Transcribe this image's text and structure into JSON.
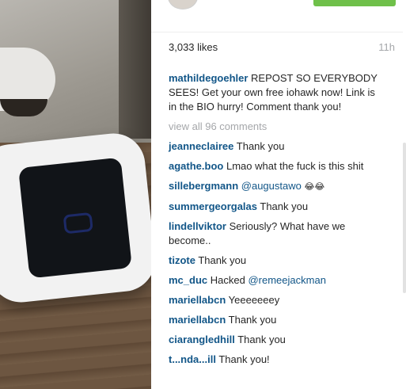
{
  "post": {
    "likes": "3,033 likes",
    "time": "11h",
    "caption": {
      "user": "mathildegoehler",
      "text": "REPOST SO EVERYBODY SEES! Get your own free iohawk now! Link is in the BIO hurry! Comment thank you!"
    },
    "view_all": "view all 96 comments"
  },
  "comments": [
    {
      "user": "jeanneclairee",
      "text": "Thank you"
    },
    {
      "user": "agathe.boo",
      "text": "Lmao what the fuck is this shit"
    },
    {
      "user": "sillebergmann",
      "mention": "@augustawo",
      "text": "😂😂"
    },
    {
      "user": "summergeorgalas",
      "text": "Thank you"
    },
    {
      "user": "lindellviktor",
      "text": "Seriously? What have we become.."
    },
    {
      "user": "tizote",
      "text": "Thank you"
    },
    {
      "user": "mc_duc",
      "text": "Hacked",
      "mention": "@remeejackman"
    },
    {
      "user": "mariellabcn",
      "text": "Yeeeeeeey"
    },
    {
      "user": "mariellabcn",
      "text": "Thank you"
    },
    {
      "user": "ciarangledhill",
      "text": "Thank you"
    },
    {
      "user": "t...nda...ill",
      "text": "Thank you!"
    }
  ],
  "colors": {
    "username": "#125688",
    "muted": "#a5a7aa",
    "follow_button": "#6fc04a"
  }
}
